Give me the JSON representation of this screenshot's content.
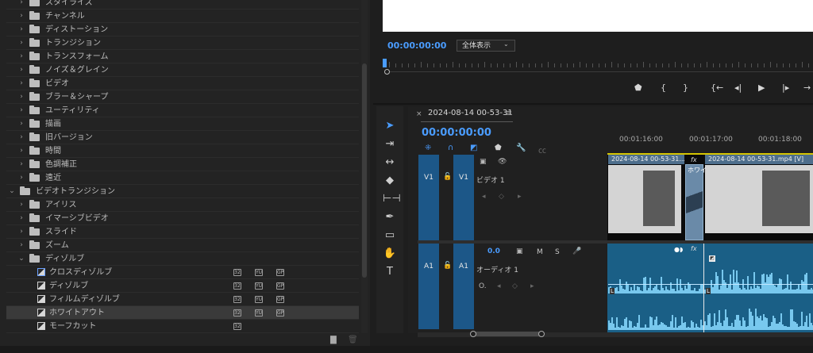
{
  "effects": {
    "rows": [
      {
        "type": "folder",
        "label": "スタイライズ",
        "open": false
      },
      {
        "type": "folder",
        "label": "チャンネル",
        "open": false
      },
      {
        "type": "folder",
        "label": "ディストーション",
        "open": false
      },
      {
        "type": "folder",
        "label": "トランジション",
        "open": false
      },
      {
        "type": "folder",
        "label": "トランスフォーム",
        "open": false
      },
      {
        "type": "folder",
        "label": "ノイズ＆グレイン",
        "open": false
      },
      {
        "type": "folder",
        "label": "ビデオ",
        "open": false
      },
      {
        "type": "folder",
        "label": "ブラー＆シャープ",
        "open": false
      },
      {
        "type": "folder",
        "label": "ユーティリティ",
        "open": false
      },
      {
        "type": "folder",
        "label": "描画",
        "open": false
      },
      {
        "type": "folder",
        "label": "旧バージョン",
        "open": false
      },
      {
        "type": "folder",
        "label": "時間",
        "open": false
      },
      {
        "type": "folder",
        "label": "色調補正",
        "open": false
      },
      {
        "type": "folder",
        "label": "遠近",
        "open": false
      },
      {
        "type": "folder",
        "label": "ビデオトランジション",
        "open": true,
        "level": 0
      },
      {
        "type": "folder",
        "label": "アイリス",
        "open": false
      },
      {
        "type": "folder",
        "label": "イマーシブビデオ",
        "open": false
      },
      {
        "type": "folder",
        "label": "スライド",
        "open": false
      },
      {
        "type": "folder",
        "label": "ズーム",
        "open": false
      },
      {
        "type": "folder",
        "label": "ディゾルブ",
        "open": true
      },
      {
        "type": "effect",
        "label": "クロスディゾルブ",
        "badges": 3,
        "highlight": true
      },
      {
        "type": "effect",
        "label": "ディゾルブ",
        "badges": 3
      },
      {
        "type": "effect",
        "label": "フィルムディゾルブ",
        "badges": 3
      },
      {
        "type": "effect",
        "label": "ホワイトアウト",
        "badges": 3,
        "selected": true
      },
      {
        "type": "effect",
        "label": "モーフカット",
        "badges": 1
      }
    ]
  },
  "monitor": {
    "timecode": "00:00:00:00",
    "fit_label": "全体表示"
  },
  "timeline": {
    "sequence_name": "2024-08-14 00-53-31",
    "timecode": "00:00:00:00",
    "ruler_labels": [
      "00:01:16:00",
      "00:01:17:00",
      "00:01:18:00"
    ],
    "v1": {
      "src": "V1",
      "target": "V1",
      "name": "ビデオ 1"
    },
    "a1": {
      "src": "A1",
      "target": "A1",
      "name": "オーディオ 1",
      "level": "0.0",
      "m": "M",
      "s": "S"
    },
    "clip1_title": "2024-08-14 00-53-31...",
    "clip2_title": "2024-08-14 00-53-31.mp4 [V]",
    "transition_label": "ホワイ",
    "fx": "fx",
    "audio_marker": "L"
  }
}
